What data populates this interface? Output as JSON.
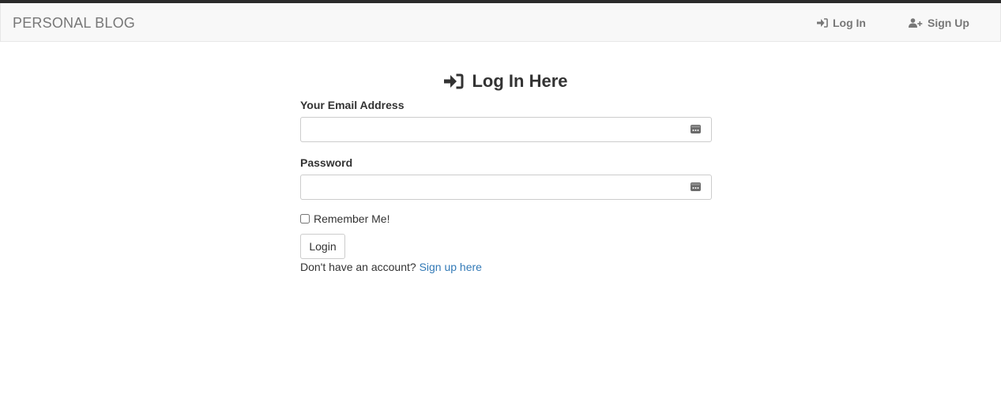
{
  "navbar": {
    "brand": "PERSONAL BLOG",
    "links": [
      {
        "label": "Log In",
        "icon": "sign-in-icon"
      },
      {
        "label": "Sign Up",
        "icon": "user-plus-icon"
      }
    ]
  },
  "form": {
    "title": "Log In Here",
    "title_icon": "sign-in-icon",
    "email": {
      "label": "Your Email Address",
      "value": "",
      "icon": "password-manager-icon"
    },
    "password": {
      "label": "Password",
      "value": "",
      "icon": "password-manager-icon"
    },
    "remember": {
      "label": "Remember Me!",
      "checked": false
    },
    "submit_label": "Login",
    "signup_prompt": "Don't have an account?",
    "signup_link": "Sign up here"
  },
  "colors": {
    "navbar_bg": "#f8f8f8",
    "top_strip": "#2b2b2b",
    "link": "#337ab7",
    "muted_text": "#777777",
    "text": "#333333"
  }
}
